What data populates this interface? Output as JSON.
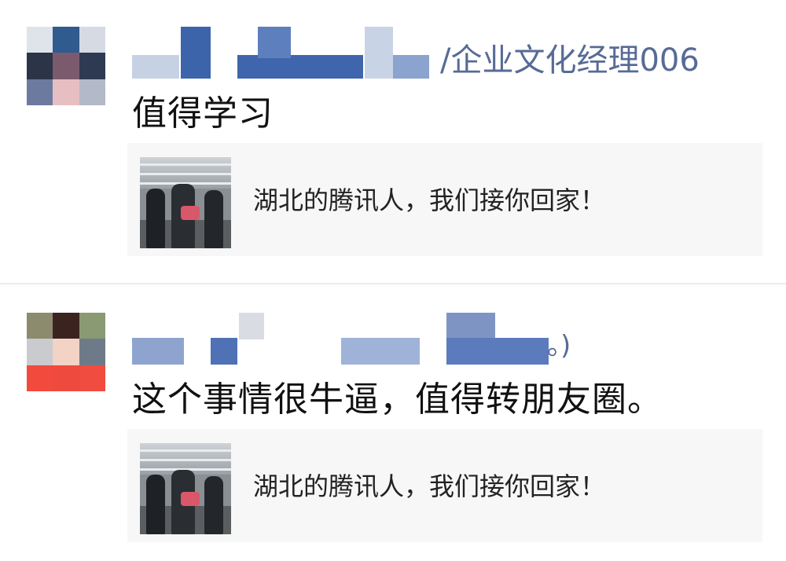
{
  "posts": [
    {
      "name_suffix": "/企业文化经理006",
      "text": "值得学习",
      "shared_link": {
        "title": "湖北的腾讯人，我们接你回家！"
      }
    },
    {
      "name_suffix": "。)",
      "text": "这个事情很牛逼，值得转朋友圈。",
      "shared_link": {
        "title": "湖北的腾讯人，我们接你回家！"
      }
    }
  ],
  "colors": {
    "link_name": "#576b95",
    "card_bg": "#f7f7f7"
  }
}
